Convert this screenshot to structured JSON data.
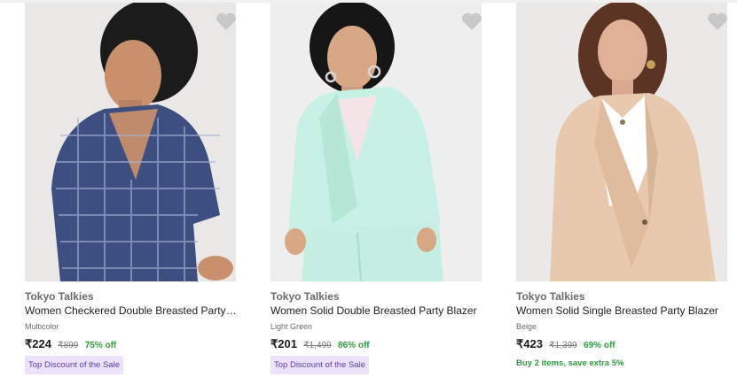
{
  "colors": {
    "accent_green": "#2e9e3f",
    "badge_bg": "#ece2fb",
    "badge_text": "#5b3da8",
    "wishlist_heart": "#c8c8c8"
  },
  "products": [
    {
      "brand": "Tokyo Talkies",
      "title": "Women Checkered Double Breasted Party Blazer",
      "color": "Multicolor",
      "price": "₹224",
      "mrp": "₹899",
      "discount": "75% off",
      "badge": "Top Discount of the Sale",
      "wishlist_icon": "heart-icon"
    },
    {
      "brand": "Tokyo Talkies",
      "title": "Women Solid Double Breasted Party Blazer",
      "color": "Light Green",
      "price": "₹201",
      "mrp": "₹1,499",
      "discount": "86% off",
      "badge": "Top Discount of the Sale",
      "wishlist_icon": "heart-icon"
    },
    {
      "brand": "Tokyo Talkies",
      "title": "Women Solid Single Breasted Party Blazer",
      "color": "Beige",
      "price": "₹423",
      "mrp": "₹1,399",
      "discount": "69% off",
      "offer": "Buy 2 items, save extra 5%",
      "wishlist_icon": "heart-icon"
    }
  ]
}
